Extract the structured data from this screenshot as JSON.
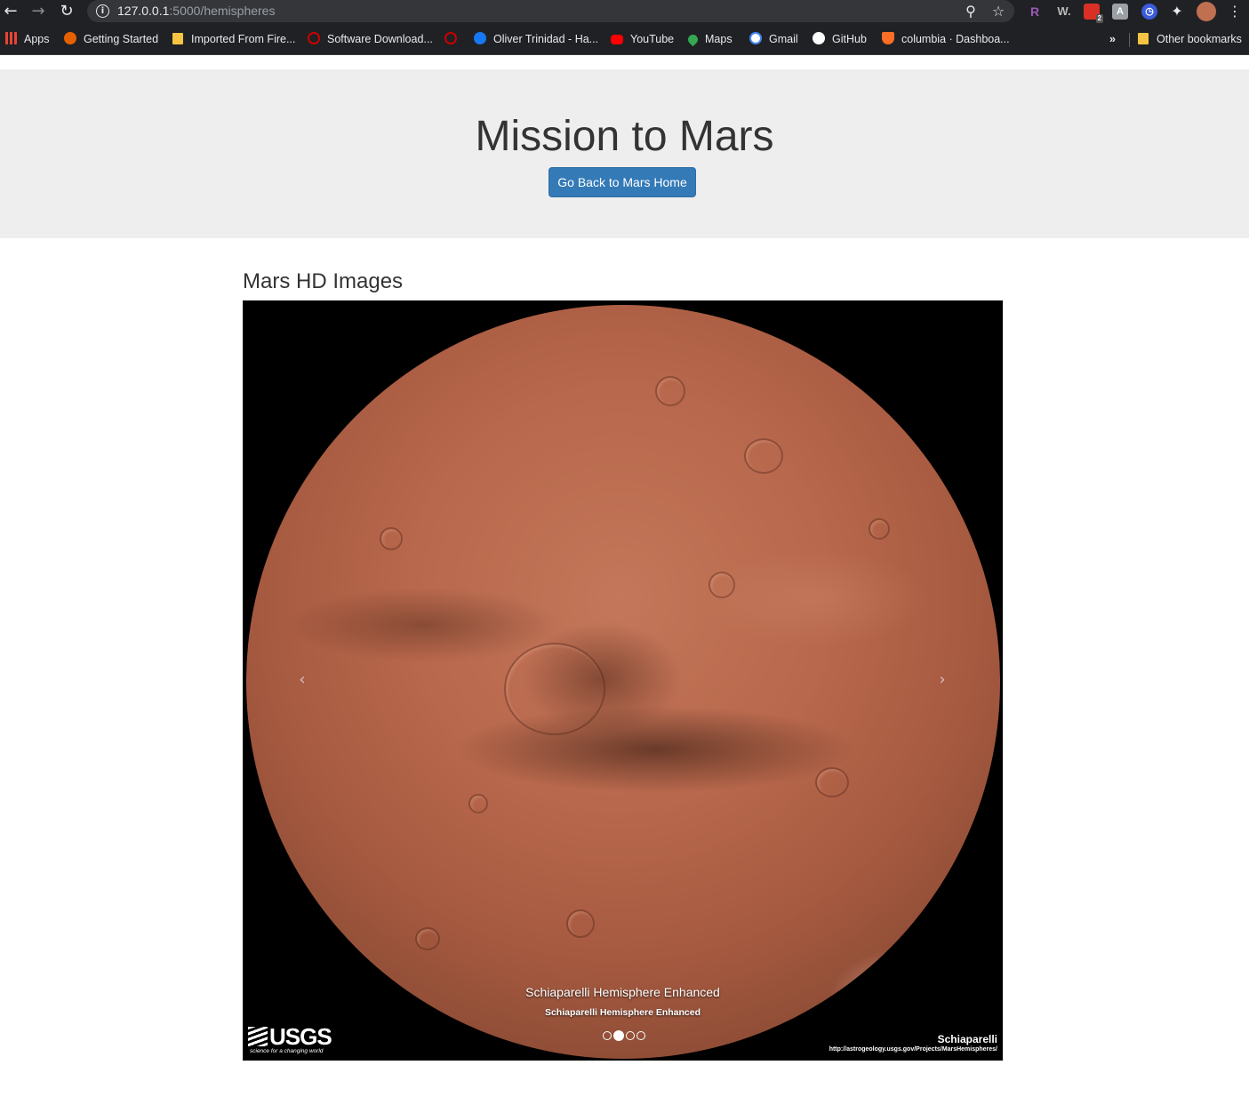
{
  "browser": {
    "url_host": "127.0.0.1",
    "url_path": ":5000/hemispheres",
    "extensions": [
      "R",
      "W.",
      "2"
    ],
    "bookmarks": [
      {
        "label": "Apps",
        "icon": "apps-grid-icon",
        "color": "#ea4335"
      },
      {
        "label": "Getting Started",
        "icon": "firefox-icon",
        "color": "#e66000"
      },
      {
        "label": "Imported From Fire...",
        "icon": "folder-icon",
        "color": "#f6c343"
      },
      {
        "label": "Software Download...",
        "icon": "redhat-link-icon",
        "color": "#cc0000"
      },
      {
        "label": "",
        "icon": "redhat-link-icon",
        "color": "#cc0000"
      },
      {
        "label": "Oliver Trinidad - Ha...",
        "icon": "facebook-icon",
        "color": "#1877f2"
      },
      {
        "label": "YouTube",
        "icon": "youtube-icon",
        "color": "#ff0000"
      },
      {
        "label": "Maps",
        "icon": "maps-pin-icon",
        "color": "#34a853"
      },
      {
        "label": "Gmail",
        "icon": "google-icon",
        "color": "#ffffff"
      },
      {
        "label": "GitHub",
        "icon": "github-icon",
        "color": "#ffffff"
      },
      {
        "label": "columbia · Dashboa...",
        "icon": "gitlab-icon",
        "color": "#fc6d26"
      }
    ],
    "overflow_label": "»",
    "other_bookmarks": "Other bookmarks"
  },
  "page": {
    "title": "Mission to Mars",
    "home_button": "Go Back to Mars Home",
    "section_title": "Mars HD Images",
    "carousel": {
      "caption_title": "Schiaparelli Hemisphere Enhanced",
      "caption_text": "Schiaparelli Hemisphere Enhanced",
      "slide_count": 4,
      "active_slide": 2,
      "prev_glyph": "‹",
      "next_glyph": "›",
      "image": {
        "logo_text": "USGS",
        "logo_tagline": "science for a changing world",
        "credit_name": "Schiaparelli",
        "credit_url": "http://astrogeology.usgs.gov/Projects/MarsHemispheres/"
      }
    }
  }
}
